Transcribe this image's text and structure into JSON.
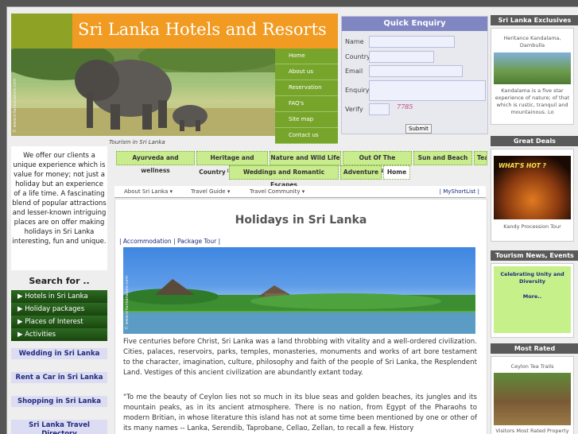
{
  "header": {
    "title": "Sri Lanka Hotels and Resorts",
    "photo_watermark": "© www.srilankanature.com"
  },
  "nav": [
    "Home",
    "About us",
    "Reservation",
    "FAQ's",
    "Site map",
    "Contact us"
  ],
  "enquiry": {
    "title": "Quick Enquiry",
    "labels": [
      "Name",
      "Country",
      "Email",
      "Enquiry",
      "Verify"
    ],
    "captcha": "7785",
    "submit": "Submit"
  },
  "left": {
    "intro": "We offer our clients a unique experience which is value for money; not just a holiday but an experience of a life time. A fascinating blend of popular attractions and lesser-known intriguing places are on offer making holidays in Sri Lanka interesting, fun and unique.",
    "search_title": "Search for ..",
    "search_items": [
      "Hotels in Sri Lanka",
      "Holiday packages",
      "Places of Interest",
      "Activities"
    ],
    "links": [
      "Wedding in Sri Lanka",
      "Rent a Car in Sri Lanka",
      "Shopping in Sri Lanka",
      "Sri Lanka Travel Directory"
    ]
  },
  "center": {
    "breadcrumb": "Tourism in Sri Lanka",
    "tabs": [
      "Ayurveda and wellness",
      "Heritage and Culture",
      "Nature and Wild Life",
      "Out Of The Ordinary",
      "Sun and Beach",
      "Tea Country",
      "Weddings and Romantic Escapes",
      "Adventure",
      "Home"
    ],
    "subnav": [
      "About Sri Lanka",
      "Travel Guide",
      "Travel Community"
    ],
    "shortlist": "MyShortList",
    "heading": "Holidays in Sri Lanka",
    "sub_links": [
      "Accommodation",
      "Package Tour"
    ],
    "hero_watermark": "© www.srilankanature.com",
    "para1": "Five centuries before Christ, Sri Lanka was a land throbbing with vitality and a well-ordered civilization. Cities, palaces, reservoirs, parks, temples, monasteries, monuments and works of art bore testament to the character, imagination, culture, philosophy and faith of the people of Sri Lanka, the Resplendent Land. Vestiges of this ancient civilization are abundantly extant today.",
    "para2": "\"To me the beauty of Ceylon lies not so much in its blue seas and golden beaches, its jungles and its mountain peaks, as in its ancient atmosphere. There is no nation, from Egypt of the Pharaohs to modern Britian, in whose literature this island has not at some time been mentioned by one or other of its many names -- Lanka, Serendib, Taprobane, Cellao, Zellan, to recall a few. History"
  },
  "right": {
    "exclusives_title": "Sri Lanka Exclusives",
    "exclusives_name": "Heritance Kandalama, Dambulla",
    "exclusives_text": "Kandalama is a five star experience of nature; of that which is rustic, tranquil and mountainous. Lo",
    "deals_title": "Great Deals",
    "deals_badge": "WHAT'S HOT ?",
    "deals_caption": "Kandy Procession Tour",
    "news_title": "Tourism News, Events",
    "news_text": "Celebrating Unity and Diversity",
    "news_more": "More..",
    "rated_title": "Most Rated",
    "rated_name": "Ceylon Tea Trails",
    "rated_caption": "Visitors Most Rated Property"
  }
}
